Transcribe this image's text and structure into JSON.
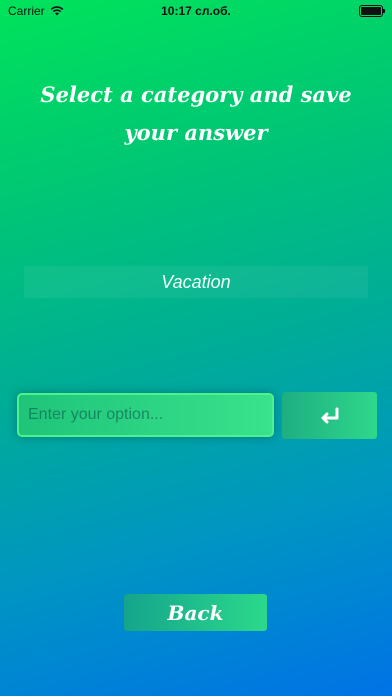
{
  "status_bar": {
    "carrier": "Carrier",
    "time": "10:17 сл.об."
  },
  "header": {
    "title": "Select a category and save your answer"
  },
  "category": {
    "label": "Vacation"
  },
  "option_input": {
    "placeholder": "Enter your option...",
    "value": ""
  },
  "enter_button": {
    "icon": "return-arrow-icon"
  },
  "back_button": {
    "label": "Back"
  }
}
